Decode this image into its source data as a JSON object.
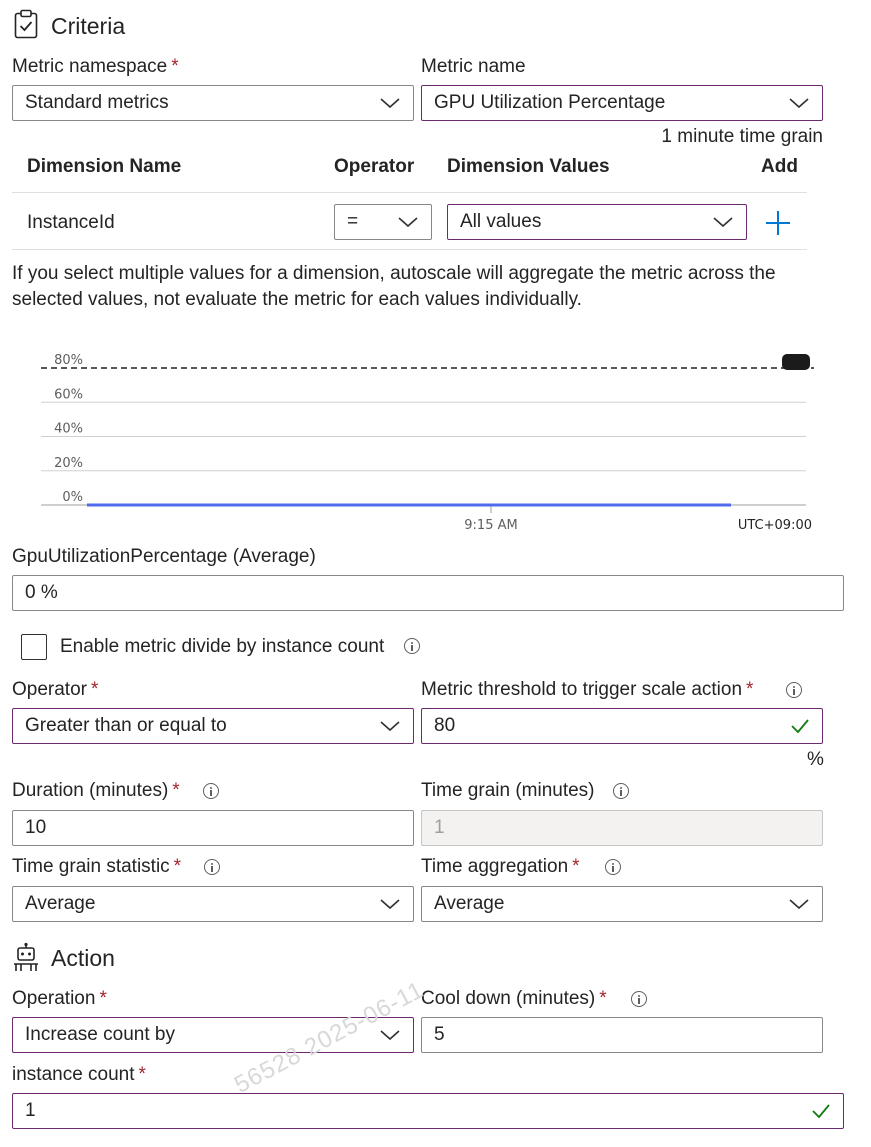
{
  "criteria": {
    "title": "Criteria",
    "metric_namespace": {
      "label": "Metric namespace",
      "value": "Standard metrics"
    },
    "metric_name": {
      "label": "Metric name",
      "value": "GPU Utilization Percentage",
      "time_grain_note": "1 minute time grain"
    },
    "dimensions": {
      "headers": [
        "Dimension Name",
        "Operator",
        "Dimension Values",
        "Add"
      ],
      "rows": [
        {
          "name": "InstanceId",
          "operator": "=",
          "values": "All values"
        }
      ]
    },
    "note": "If you select multiple values for a dimension, autoscale will aggregate the metric across the selected values, not evaluate the metric for each values individually.",
    "metric_readout": {
      "label": "GpuUtilizationPercentage (Average)",
      "value": "0 %"
    },
    "divide_checkbox": {
      "label": "Enable metric divide by instance count",
      "checked": false
    },
    "operator": {
      "label": "Operator",
      "value": "Greater than or equal to"
    },
    "threshold": {
      "label": "Metric threshold to trigger scale action",
      "value": "80",
      "unit": "%"
    },
    "duration": {
      "label": "Duration (minutes)",
      "value": "10"
    },
    "time_grain": {
      "label": "Time grain (minutes)",
      "value": "1"
    },
    "time_grain_statistic": {
      "label": "Time grain statistic",
      "value": "Average"
    },
    "time_aggregation": {
      "label": "Time aggregation",
      "value": "Average"
    }
  },
  "action": {
    "title": "Action",
    "operation": {
      "label": "Operation",
      "value": "Increase count by"
    },
    "cool_down": {
      "label": "Cool down (minutes)",
      "value": "5"
    },
    "instance_count": {
      "label": "instance count",
      "value": "1"
    }
  },
  "required_marker": "*",
  "watermark": "56528  2025-06-11",
  "colors": {
    "accent": "#0078d4",
    "required": "#a4262c",
    "focus_border": "#6b2a6e",
    "series": "#4f6bed",
    "valid": "#107c10"
  },
  "chart_data": {
    "type": "line",
    "y_ticks": [
      "80%",
      "60%",
      "40%",
      "20%",
      "0%"
    ],
    "ylim": [
      0,
      80
    ],
    "x_tick_label": "9:15 AM",
    "timezone_label": "UTC+09:00",
    "threshold": 80,
    "series": [
      {
        "values": [
          0,
          0
        ]
      }
    ],
    "grid": true
  }
}
